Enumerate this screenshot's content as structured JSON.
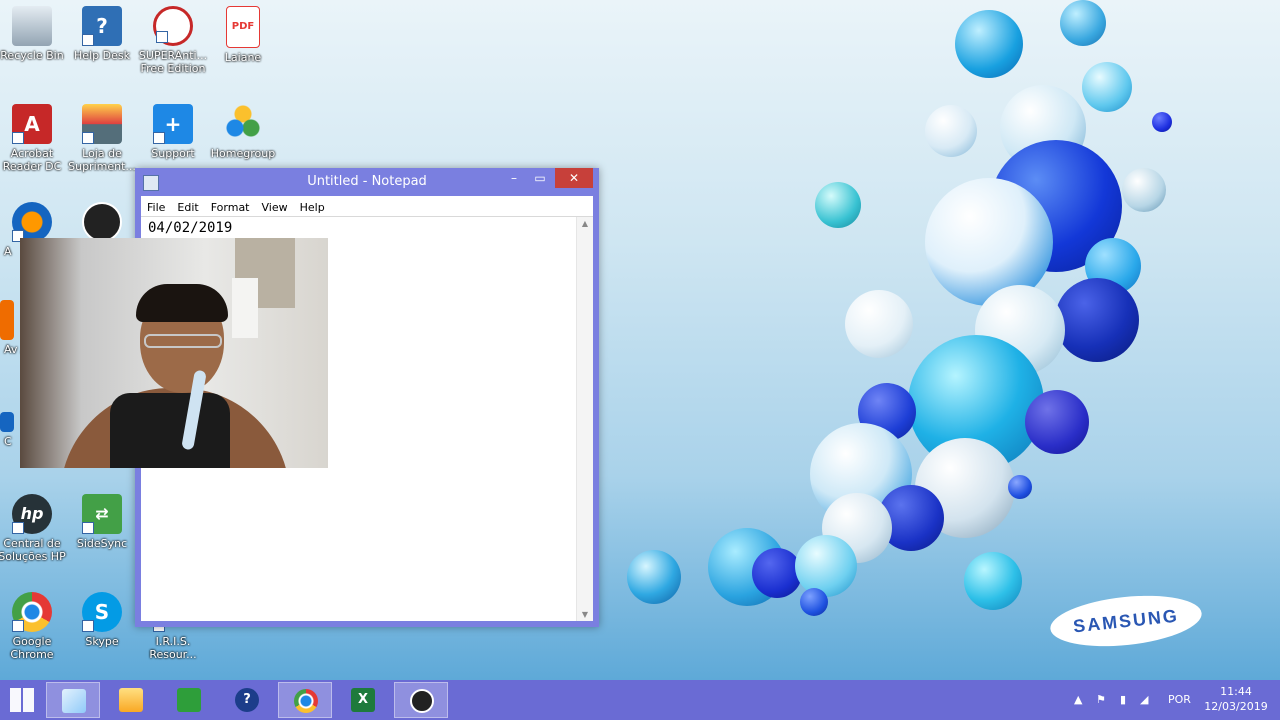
{
  "desktop_icons": [
    {
      "label": "Recycle Bin",
      "icon": "recycle-bin-icon",
      "color": "#9aa5b1"
    },
    {
      "label": "Help Desk",
      "icon": "help-desk-icon",
      "color": "#2f6fb5"
    },
    {
      "label": "SUPERAnti... Free Edition",
      "icon": "superantispyware-icon",
      "color": "#c62828"
    },
    {
      "label": "Laiane",
      "icon": "pdf-file-icon",
      "color": "#e53935"
    },
    {
      "label": "Acrobat Reader DC",
      "icon": "acrobat-reader-icon",
      "color": "#c62828"
    },
    {
      "label": "Loja de Supriment...",
      "icon": "printer-store-icon",
      "color": "#546e7a"
    },
    {
      "label": "Support",
      "icon": "support-icon",
      "color": "#1e88e5"
    },
    {
      "label": "Homegroup",
      "icon": "homegroup-icon",
      "color": "#43a047"
    },
    {
      "label": "Central de Soluções HP",
      "icon": "hp-icon",
      "color": "#263238"
    },
    {
      "label": "SideSync",
      "icon": "sidesync-icon",
      "color": "#43a047"
    },
    {
      "label": "Google Chrome",
      "icon": "chrome-icon",
      "color": "#e53935"
    },
    {
      "label": "Skype",
      "icon": "skype-icon",
      "color": "#039be5"
    },
    {
      "label": "I.R.I.S. Resour...",
      "icon": "iris-icon",
      "color": "#ffffff"
    }
  ],
  "partial_icon_labels": [
    "A",
    "Av Ai",
    "C"
  ],
  "notepad": {
    "title": "Untitled - Notepad",
    "menu": [
      "File",
      "Edit",
      "Format",
      "View",
      "Help"
    ],
    "content": "04/02/2019",
    "close_glyph": "✕",
    "max_glyph": "▭",
    "min_glyph": "–"
  },
  "brand": "SAMSUNG",
  "taskbar": {
    "items": [
      {
        "name": "start-button",
        "icon": "windows-logo-icon"
      },
      {
        "name": "taskbar-notepad",
        "icon": "notepad-icon",
        "active": true
      },
      {
        "name": "taskbar-file-explorer",
        "icon": "folder-icon"
      },
      {
        "name": "taskbar-store",
        "icon": "store-icon"
      },
      {
        "name": "taskbar-help",
        "icon": "help-icon"
      },
      {
        "name": "taskbar-chrome",
        "icon": "chrome-icon",
        "active": true
      },
      {
        "name": "taskbar-excel",
        "icon": "excel-icon"
      },
      {
        "name": "taskbar-obs",
        "icon": "obs-icon",
        "active": true
      }
    ],
    "tray_language": "POR",
    "clock_time": "11:44",
    "clock_date": "12/03/2019"
  }
}
